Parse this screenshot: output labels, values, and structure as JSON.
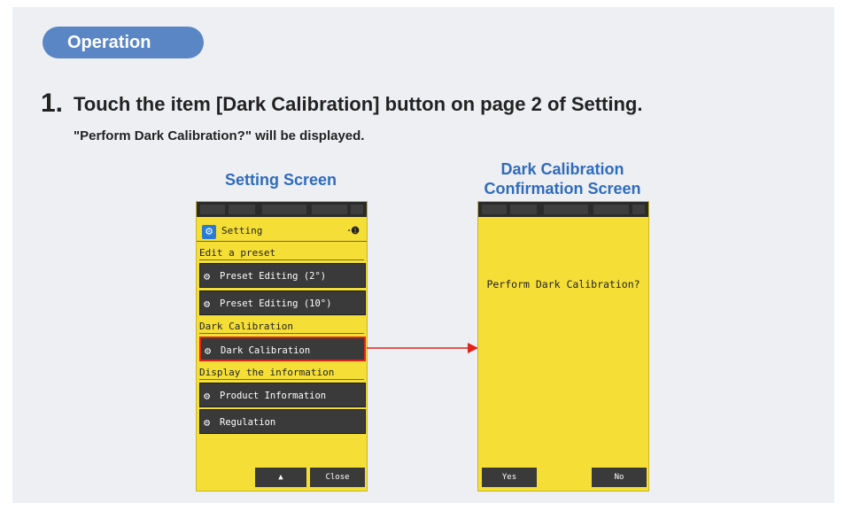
{
  "operation_label": "Operation",
  "step": {
    "number": "1.",
    "title": "Touch the item [Dark Calibration] button on page 2 of Setting.",
    "subtitle": "\"Perform Dark Calibration?\" will be displayed."
  },
  "captions": {
    "left": "Setting Screen",
    "right_line1": "Dark Calibration",
    "right_line2": "Confirmation Screen"
  },
  "setting_screen": {
    "header": "Setting",
    "help": "·❶",
    "sections": [
      {
        "title": "Edit a preset",
        "buttons": [
          "Preset Editing (2°)",
          "Preset Editing (10°)"
        ]
      },
      {
        "title": "Dark Calibration",
        "buttons": [
          "Dark Calibration"
        ]
      },
      {
        "title": "Display the information",
        "buttons": [
          "Product Information",
          "Regulation"
        ]
      }
    ],
    "bottom_up": "▲",
    "bottom_close": "Close",
    "highlight_color": "#e0241b"
  },
  "confirm_screen": {
    "message": "Perform Dark Calibration?",
    "yes": "Yes",
    "no": "No"
  },
  "icons": {
    "gear": "gear-icon",
    "setting": "setting-icon",
    "arrow": "arrow-right-icon"
  },
  "colors": {
    "accent": "#5b86c5",
    "caption": "#2f6bbd",
    "screen_bg": "#f5df36",
    "arrow": "#e0241b"
  }
}
